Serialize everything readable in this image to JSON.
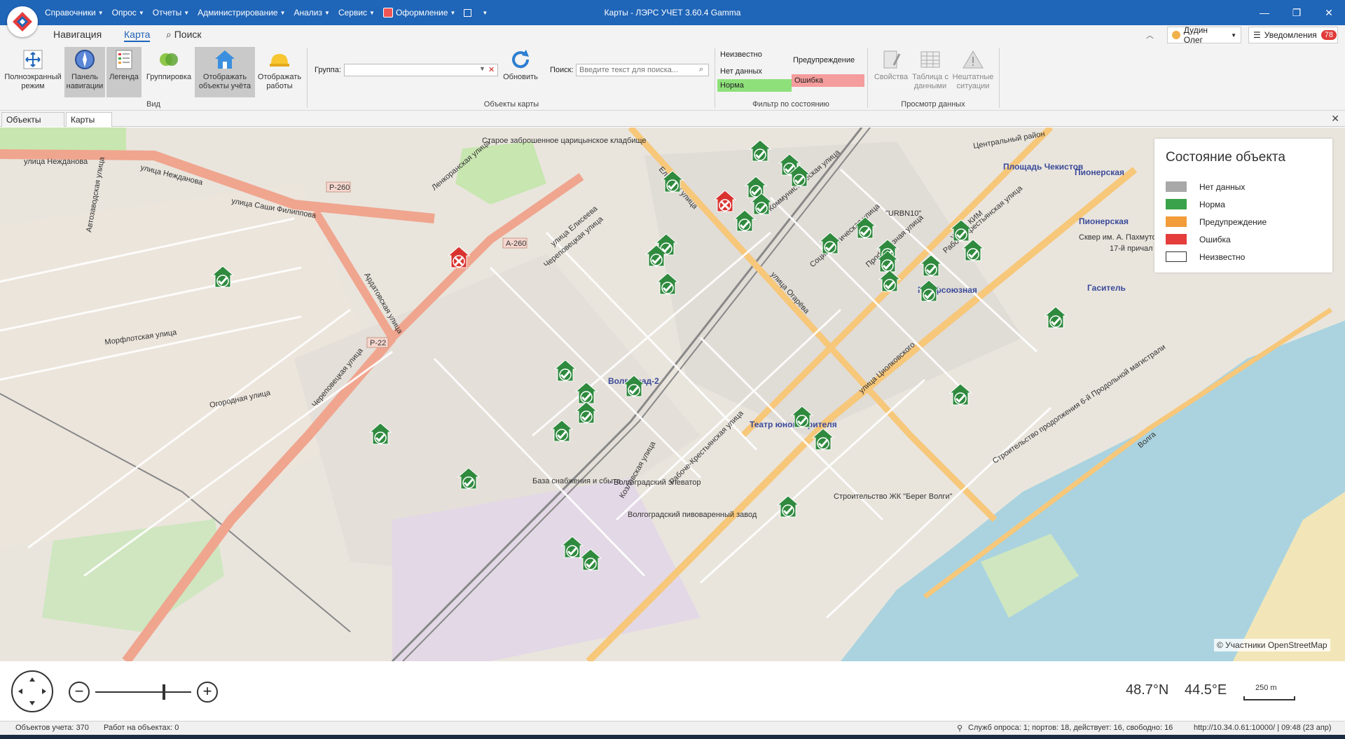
{
  "window": {
    "title": "Карты - ЛЭРС УЧЕТ 3.60.4 Gamma",
    "minimize": "—",
    "maximize": "❐",
    "close": "✕"
  },
  "menu": [
    {
      "label": "Справочники"
    },
    {
      "label": "Опрос"
    },
    {
      "label": "Отчеты"
    },
    {
      "label": "Администрирование"
    },
    {
      "label": "Анализ"
    },
    {
      "label": "Сервис"
    },
    {
      "label": "Оформление"
    }
  ],
  "ribbon_tabs": {
    "navigation": "Навигация",
    "map": "Карта",
    "search": "Поиск"
  },
  "user": {
    "name": "Дудин Олег"
  },
  "notifications": {
    "label": "Уведомления",
    "count": "78"
  },
  "ribbon": {
    "view": {
      "fullscreen": [
        "Полноэкранный",
        "режим"
      ],
      "nav_panel": [
        "Панель",
        "навигации"
      ],
      "legend": [
        "Легенда"
      ],
      "grouping": [
        "Группировка"
      ],
      "show_objects": [
        "Отображать",
        "объекты учёта"
      ],
      "show_works": [
        "Отображать",
        "работы"
      ],
      "group_label": "Вид"
    },
    "map_objects": {
      "group_field_label": "Группа:",
      "refresh": "Обновить",
      "search_label": "Поиск:",
      "search_placeholder": "Введите текст для поиска...",
      "group_label": "Объекты карты"
    },
    "state_filter": {
      "unknown": "Неизвестно",
      "no_data": "Нет данных",
      "normal": "Норма",
      "warning": "Предупреждение",
      "error": "Ошибка",
      "group_label": "Фильтр по состоянию"
    },
    "data_view": {
      "properties": [
        "Свойства"
      ],
      "data_table": [
        "Таблица с",
        "данными"
      ],
      "emergencies": [
        "Нештатные",
        "ситуации"
      ],
      "group_label": "Просмотр данных"
    }
  },
  "doc_tabs": [
    {
      "label": "Объекты учета"
    },
    {
      "label": "Карты"
    }
  ],
  "legend": {
    "title": "Состояние объекта",
    "items": [
      {
        "label": "Нет данных",
        "color": "#a8a8a8"
      },
      {
        "label": "Норма",
        "color": "#3aa24a"
      },
      {
        "label": "Предупреждение",
        "color": "#f39c3a"
      },
      {
        "label": "Ошибка",
        "color": "#e53c3c"
      },
      {
        "label": "Неизвестно",
        "color": "#ffffff"
      }
    ]
  },
  "map": {
    "credit": "© Участники OpenStreetMap",
    "road_labels": [
      "улица Нежданова",
      "улица Нежданова",
      "улица Саши Филиппова",
      "Ардатовская улица",
      "Череповецкая улица",
      "Череповецкая улица",
      "Ленкоранская улица",
      "Елецкая улица",
      "улица Огарёва",
      "Профсоюзная улица",
      "Рабоче-Крестьянская улица",
      "Рабоче-Крестьянская улица",
      "Строительство продолжения 6-й Продольной магистрали",
      "Козловская улица",
      "Морфлотская улица",
      "Огородная улица",
      "Автозаводская улица",
      "улица Елисеева",
      "Социалистическая улица",
      "улица Циолковского",
      "улица КИМ",
      "Коммунистическая улица"
    ],
    "road_badges": [
      "Р-260",
      "А-260",
      "Р-22"
    ],
    "place_labels": [
      "Волгоград-2",
      "Профсоюзная",
      "Пионерская",
      "Площадь Чекистов",
      "Пионерская",
      "Гаситель",
      "Театр юного зрителя"
    ],
    "misc_labels": [
      "Старое заброшенное царицынское кладбище",
      "\"URBN10\"",
      "Волга",
      "База снабжения и сбыта",
      "Волгоградский элеватор",
      "Волгоградский пивоваренный завод",
      "Строительство ЖК \"Берег Волги\"",
      "Сквер им. А. Пахмутовой",
      "17-й причал",
      "Центральный район"
    ],
    "markers": [
      {
        "state": "normal"
      },
      {
        "state": "normal"
      },
      {
        "state": "normal"
      },
      {
        "state": "normal"
      },
      {
        "state": "normal"
      },
      {
        "state": "normal"
      },
      {
        "state": "normal"
      },
      {
        "state": "error"
      },
      {
        "state": "normal"
      },
      {
        "state": "normal"
      },
      {
        "state": "normal"
      },
      {
        "state": "normal"
      },
      {
        "state": "normal"
      },
      {
        "state": "normal"
      },
      {
        "state": "normal"
      },
      {
        "state": "normal"
      },
      {
        "state": "normal"
      },
      {
        "state": "normal"
      },
      {
        "state": "normal"
      },
      {
        "state": "normal"
      },
      {
        "state": "error"
      },
      {
        "state": "normal"
      },
      {
        "state": "normal"
      },
      {
        "state": "normal"
      },
      {
        "state": "normal"
      },
      {
        "state": "normal"
      },
      {
        "state": "normal"
      },
      {
        "state": "normal"
      },
      {
        "state": "normal"
      },
      {
        "state": "normal"
      },
      {
        "state": "normal"
      },
      {
        "state": "normal"
      },
      {
        "state": "normal"
      },
      {
        "state": "normal"
      },
      {
        "state": "normal"
      },
      {
        "state": "normal"
      }
    ]
  },
  "map_controls": {
    "zoom_out": "−",
    "zoom_in": "+",
    "latitude": "48.7°N",
    "longitude": "44.5°E",
    "scale": "250 m"
  },
  "status": {
    "objects": "Объектов учета: 370",
    "works": "Работ на объектах: 0",
    "services": "Служб опроса: 1; портов: 18, действует: 16, свободно: 16",
    "server": "http://10.34.0.61:10000/ | 09:48 (23 апр)"
  }
}
